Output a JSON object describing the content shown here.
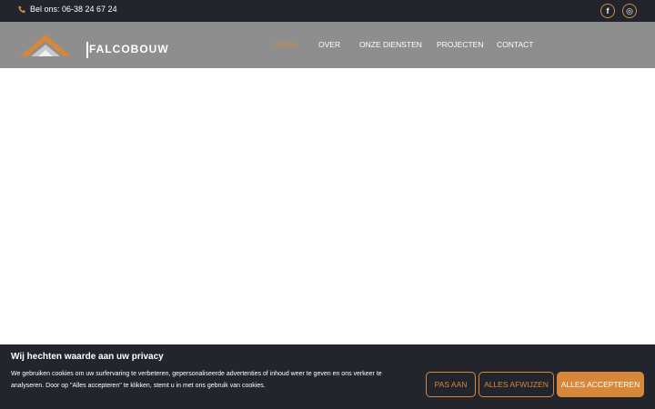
{
  "topbar": {
    "phone_text": "Bel ons: 06-38 24 67 24",
    "phone_icon": "phone-icon",
    "social": [
      {
        "icon": "facebook-icon",
        "glyph": "f"
      },
      {
        "icon": "instagram-icon",
        "glyph": "◎"
      }
    ]
  },
  "header": {
    "logo_text": "FALCOBOUW",
    "nav": [
      {
        "label": "HOME",
        "active": true
      },
      {
        "label": "OVER",
        "active": false
      },
      {
        "label": "ONZE DIENSTEN",
        "active": false
      },
      {
        "label": "PROJECTEN",
        "active": false
      },
      {
        "label": "CONTACT",
        "active": false
      }
    ]
  },
  "cookie_banner": {
    "title": "Wij hechten waarde aan uw privacy",
    "text": "We gebruiken cookies om uw surfervaring te verbeteren, gepersonaliseerde advertenties of inhoud weer te geven en ons verkeer te analyseren. Door op \"Alles accepteren\" te klikken, stemt u in met ons gebruik van cookies.",
    "customize_label": "PAS AAN",
    "reject_label": "ALLES AFWIJZEN",
    "accept_label": "ALLES ACCEPTEREN"
  },
  "colors": {
    "accent": "#d6873a",
    "dark": "#23252d",
    "header_bg": "#8e8e8f"
  }
}
